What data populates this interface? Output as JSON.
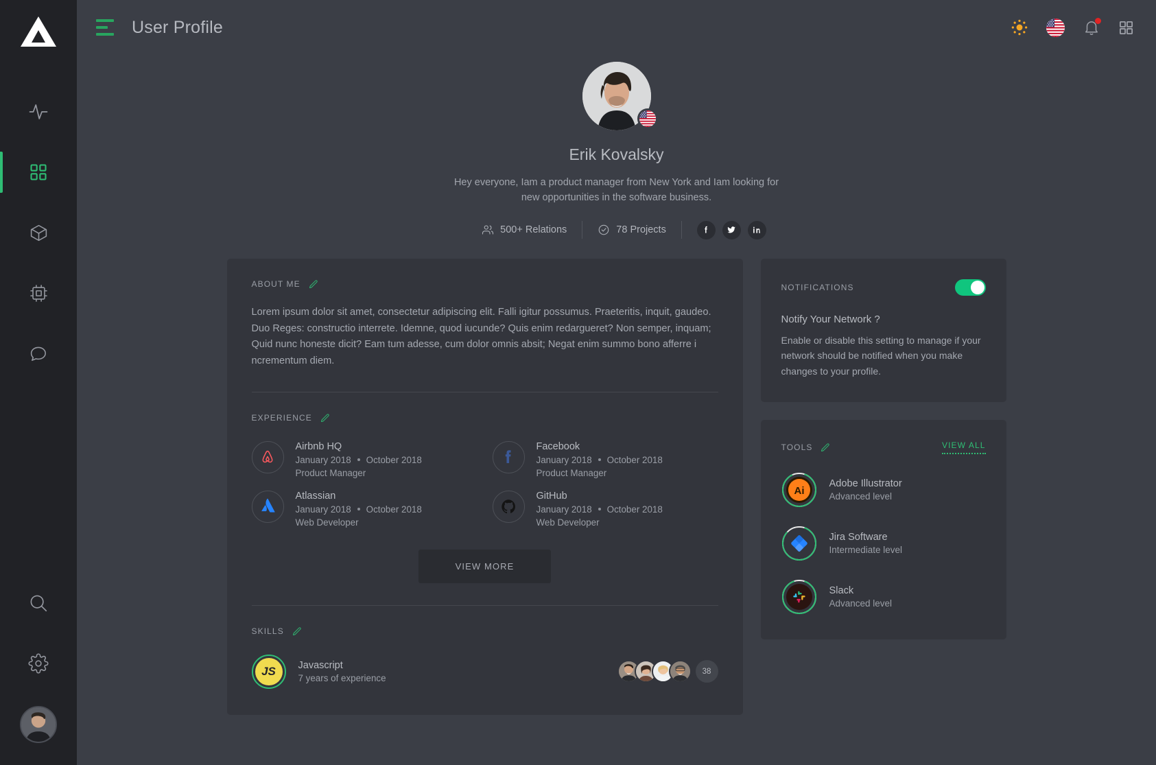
{
  "sidebar": {
    "logo": "triangle-logo",
    "items": [
      {
        "icon": "activity-pulse-icon",
        "name": "activity",
        "active": false
      },
      {
        "icon": "grid-dashboard-icon",
        "name": "dashboard",
        "active": true
      },
      {
        "icon": "cube-box-icon",
        "name": "packages",
        "active": false
      },
      {
        "icon": "chip-cpu-icon",
        "name": "devices",
        "active": false
      },
      {
        "icon": "chat-bubble-icon",
        "name": "messages",
        "active": false
      }
    ],
    "bottom_items": [
      {
        "icon": "search-icon",
        "name": "search"
      },
      {
        "icon": "gear-settings-icon",
        "name": "settings"
      }
    ],
    "avatar": "user-avatar"
  },
  "topbar": {
    "menu_icon": "hamburger-menu-icon",
    "title": "User Profile",
    "theme_icon": "sun-brightness-icon",
    "language_flag": "us-flag-icon",
    "notifications_icon": "bell-icon",
    "has_notification_badge": true,
    "apps_icon": "grid-apps-icon"
  },
  "profile": {
    "avatar": "profile-photo",
    "flag": "us-flag-badge",
    "name": "Erik Kovalsky",
    "bio": "Hey everyone,  Iam a product manager from New York and Iam looking for new opportunities in the software business.",
    "stats": [
      {
        "icon": "people-icon",
        "label": "500+ Relations"
      },
      {
        "icon": "check-circle-icon",
        "label": "78 Projects"
      }
    ],
    "socials": [
      {
        "icon": "facebook-icon",
        "name": "facebook"
      },
      {
        "icon": "twitter-icon",
        "name": "twitter"
      },
      {
        "icon": "linkedin-icon",
        "name": "linkedin"
      }
    ]
  },
  "about": {
    "heading": "ABOUT ME",
    "edit_icon": "pencil-edit-icon",
    "text": "Lorem ipsum dolor sit amet, consectetur adipiscing elit. Falli igitur possumus. Praeteritis, inquit, gaudeo. Duo Reges: constructio interrete. Idemne, quod iucunde? Quis enim redargueret? Non semper, inquam; Quid nunc honeste dicit? Eam tum adesse, cum dolor omnis absit; Negat enim summo bono afferre i ncrementum diem."
  },
  "experience": {
    "heading": "EXPERIENCE",
    "edit_icon": "pencil-edit-icon",
    "items": [
      {
        "logo": "airbnb-icon",
        "company": "Airbnb HQ",
        "start": "January 2018",
        "end": "October 2018",
        "role": "Product Manager"
      },
      {
        "logo": "facebook-icon",
        "company": "Facebook",
        "start": "January 2018",
        "end": "October 2018",
        "role": "Product Manager"
      },
      {
        "logo": "atlassian-icon",
        "company": "Atlassian",
        "start": "January 2018",
        "end": "October 2018",
        "role": "Web Developer"
      },
      {
        "logo": "github-icon",
        "company": "GitHub",
        "start": "January 2018",
        "end": "October 2018",
        "role": "Web Developer"
      }
    ],
    "view_more_label": "VIEW MORE"
  },
  "skills": {
    "heading": "SKILLS",
    "edit_icon": "pencil-edit-icon",
    "items": [
      {
        "badge": "javascript-icon",
        "badge_text": "JS",
        "name": "Javascript",
        "detail": "7 years of experience",
        "avatar_count": 4,
        "extra_count": "38"
      }
    ]
  },
  "notifications": {
    "heading": "NOTIFICATIONS",
    "toggle_on": true,
    "question": "Notify Your Network ?",
    "description": "Enable or disable this setting to manage if your network should be notified when you make changes to your profile."
  },
  "tools": {
    "heading": "TOOLS",
    "edit_icon": "pencil-edit-icon",
    "view_all_label": "VIEW ALL",
    "items": [
      {
        "icon": "adobe-illustrator-icon",
        "name": "Adobe Illustrator",
        "level": "Advanced level",
        "progress": 88
      },
      {
        "icon": "jira-software-icon",
        "name": "Jira Software",
        "level": "Intermediate level",
        "progress": 82
      },
      {
        "icon": "slack-icon",
        "name": "Slack",
        "level": "Advanced level",
        "progress": 90
      }
    ]
  },
  "colors": {
    "accent_green": "#2fbd74",
    "toggle_green": "#10c57e",
    "bg": "#3b3e46",
    "card_bg": "#33353c",
    "rail_bg": "#212226",
    "badge_red": "#e02424"
  }
}
